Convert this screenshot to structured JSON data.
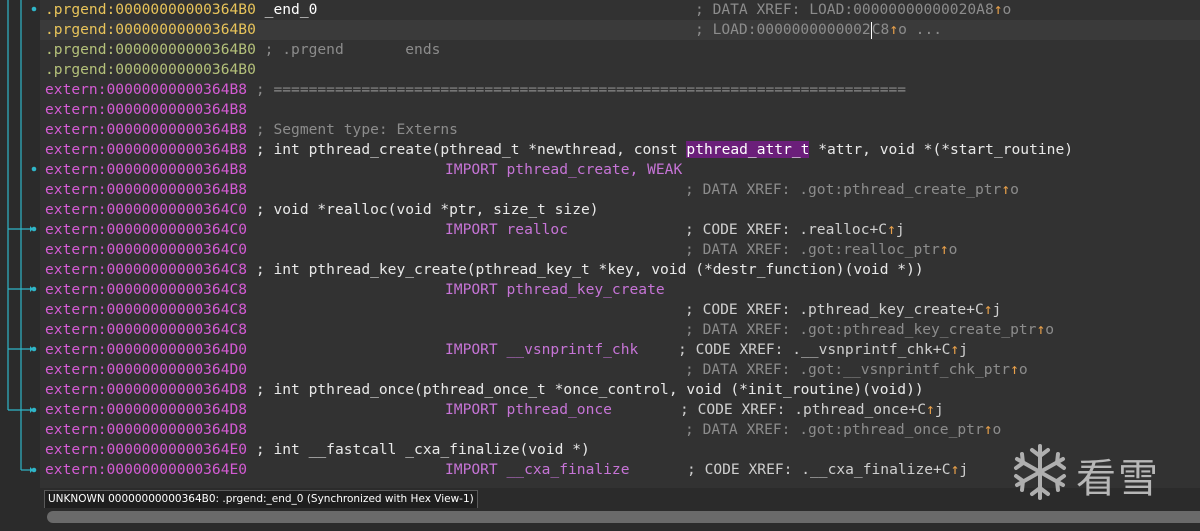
{
  "lines": [
    {
      "addr": ".prgend:00000000000364B0",
      "addr_color": "prg",
      "sym": "_end_0",
      "comment": "; DATA XREF: LOAD:00000000000020A8",
      "arrow": "↑",
      "suffix": "o",
      "current": false
    },
    {
      "addr": ".prgend:00000000000364B0",
      "addr_color": "prg",
      "sym": "",
      "comment": "; LOAD:0000000000002",
      "comment_b": "C8",
      "arrow": "↑",
      "suffix": "o ...",
      "current": true
    },
    {
      "addr": ".prgend:00000000000364B0",
      "addr_color": "prg2",
      "text": "; .prgend       ends",
      "current": false
    },
    {
      "addr": ".prgend:00000000000364B0",
      "addr_color": "prg2",
      "text": "",
      "current": false
    },
    {
      "addr": "extern:00000000000364B8",
      "text": "; ========================================================================"
    },
    {
      "addr": "extern:00000000000364B8",
      "text": ""
    },
    {
      "addr": "extern:00000000000364B8",
      "text": "; Segment type: Externs"
    },
    {
      "addr": "extern:00000000000364B8",
      "code_pre": "; int pthread_create(pthread_t *newthread, const ",
      "code_hl": "pthread_attr_t",
      "code_post": " *attr, void *(*start_routine)"
    },
    {
      "addr": "extern:00000000000364B8",
      "import": "IMPORT pthread_create, WEAK"
    },
    {
      "addr": "extern:00000000000364B8",
      "comment": "; DATA XREF: .got:pthread_create_ptr",
      "arrow": "↑",
      "suffix": "o"
    },
    {
      "addr": "extern:00000000000364C0",
      "code": "; void *realloc(void *ptr, size_t size)"
    },
    {
      "addr": "extern:00000000000364C0",
      "import": "IMPORT realloc",
      "comment": "; CODE XREF: .realloc+C",
      "arrow": "↑",
      "suffix": "j"
    },
    {
      "addr": "extern:00000000000364C0",
      "comment": "; DATA XREF: .got:realloc_ptr",
      "arrow": "↑",
      "suffix": "o"
    },
    {
      "addr": "extern:00000000000364C8",
      "code": "; int pthread_key_create(pthread_key_t *key, void (*destr_function)(void *))"
    },
    {
      "addr": "extern:00000000000364C8",
      "import": "IMPORT pthread_key_create"
    },
    {
      "addr": "extern:00000000000364C8",
      "comment": "; CODE XREF: .pthread_key_create+C",
      "arrow": "↑",
      "suffix": "j"
    },
    {
      "addr": "extern:00000000000364C8",
      "comment": "; DATA XREF: .got:pthread_key_create_ptr",
      "arrow": "↑",
      "suffix": "o"
    },
    {
      "addr": "extern:00000000000364D0",
      "import": "IMPORT __vsnprintf_chk",
      "comment": "; CODE XREF: .__vsnprintf_chk+C",
      "arrow": "↑",
      "suffix": "j"
    },
    {
      "addr": "extern:00000000000364D0",
      "comment": "; DATA XREF: .got:__vsnprintf_chk_ptr",
      "arrow": "↑",
      "suffix": "o"
    },
    {
      "addr": "extern:00000000000364D8",
      "code": "; int pthread_once(pthread_once_t *once_control, void (*init_routine)(void))"
    },
    {
      "addr": "extern:00000000000364D8",
      "import": "IMPORT pthread_once",
      "comment": "; CODE XREF: .pthread_once+C",
      "arrow": "↑",
      "suffix": "j"
    },
    {
      "addr": "extern:00000000000364D8",
      "comment": "; DATA XREF: .got:pthread_once_ptr",
      "arrow": "↑",
      "suffix": "o"
    },
    {
      "addr": "extern:00000000000364E0",
      "code": "; int __fastcall _cxa_finalize(void *)"
    },
    {
      "addr": "extern:00000000000364E0",
      "import": "IMPORT __cxa_finalize",
      "comment": "; CODE XREF: .__cxa_finalize+C",
      "arrow": "↑",
      "suffix": "j"
    }
  ],
  "status_bar": {
    "text": "UNKNOWN 00000000000364B0: .prgend:_end_0 (Synchronized with Hex View-1)"
  },
  "watermark": {
    "text": "看雪",
    "icon": "snowflake-icon"
  },
  "colors": {
    "background": "#323232",
    "address_prgend": "#e8c45a",
    "address_extern": "#d35bd3",
    "highlight": "#6b1f7a",
    "arrow": "#e8a04a"
  }
}
